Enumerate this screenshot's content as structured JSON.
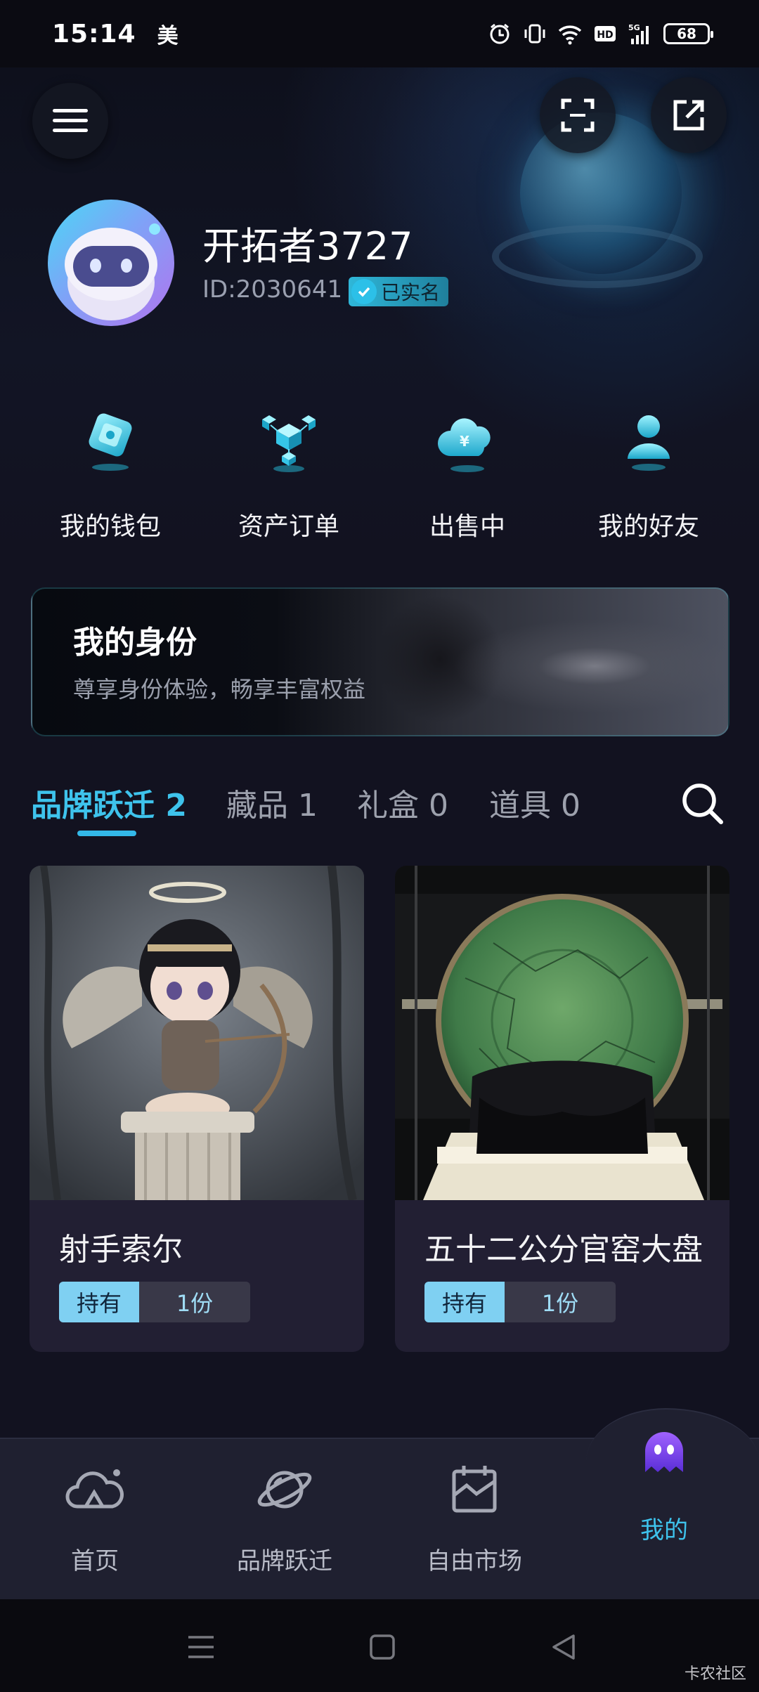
{
  "status_bar": {
    "time": "15:14",
    "carrier": "美",
    "battery": "68",
    "icons": [
      "alarm-icon",
      "vibrate-icon",
      "wifi-icon",
      "hd-icon",
      "signal-5g-icon",
      "battery-icon"
    ]
  },
  "header": {
    "icons": [
      "menu-icon",
      "scan-icon",
      "share-icon"
    ]
  },
  "profile": {
    "nickname": "开拓者3727",
    "id": "ID:2030641",
    "verified_label": "已实名"
  },
  "quick_menu": [
    {
      "label": "我的钱包",
      "icon": "wallet-icon"
    },
    {
      "label": "资产订单",
      "icon": "asset-order-icon"
    },
    {
      "label": "出售中",
      "icon": "on-sale-icon"
    },
    {
      "label": "我的好友",
      "icon": "friends-icon"
    }
  ],
  "identity_banner": {
    "title": "我的身份",
    "subtitle": "尊享身份体验，畅享丰富权益"
  },
  "tabs": [
    {
      "label": "品牌跃迁",
      "count": "2",
      "active": true
    },
    {
      "label": "藏品",
      "count": "1",
      "active": false
    },
    {
      "label": "礼盒",
      "count": "0",
      "active": false
    },
    {
      "label": "道具",
      "count": "0",
      "active": false
    }
  ],
  "cards": [
    {
      "title": "射手索尔",
      "holding_label": "持有",
      "holding_count": "1份"
    },
    {
      "title": "五十二公分官窑大盘",
      "holding_label": "持有",
      "holding_count": "1份"
    }
  ],
  "bottom_nav": [
    {
      "label": "首页",
      "icon": "home-cloud-icon",
      "active": false
    },
    {
      "label": "品牌跃迁",
      "icon": "planet-icon",
      "active": false
    },
    {
      "label": "自由市场",
      "icon": "market-icon",
      "active": false
    },
    {
      "label": "我的",
      "icon": "mascot-icon",
      "active": true
    }
  ],
  "watermark": "卡农社区",
  "colors": {
    "background": "#121220",
    "accent": "#3ec3ec",
    "card": "#221f33",
    "nav": "#1f2030"
  }
}
